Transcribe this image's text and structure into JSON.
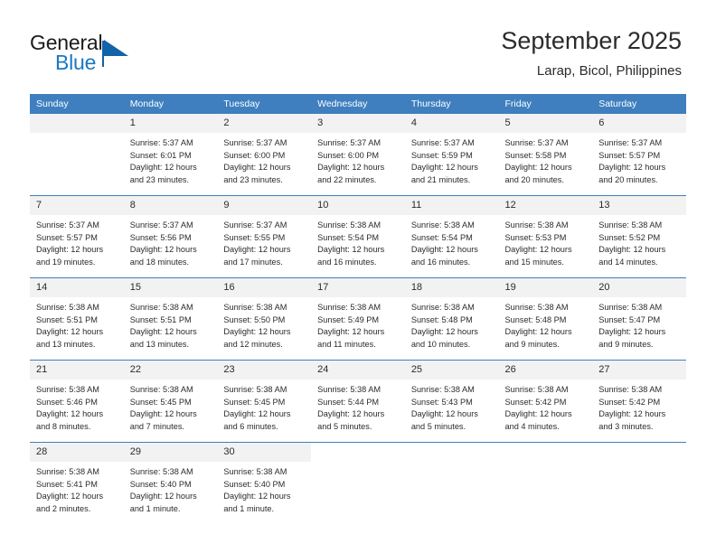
{
  "brand": {
    "name_part1": "General",
    "name_part2": "Blue",
    "logo_icon": "triangle-logo-icon",
    "accent_color": "#1878c4"
  },
  "header": {
    "title": "September 2025",
    "subtitle": "Larap, Bicol, Philippines"
  },
  "theme": {
    "header_bg": "#3f7fbf",
    "daynum_bg": "#f2f2f2",
    "text": "#2b2b2b"
  },
  "weekday_headers": [
    "Sunday",
    "Monday",
    "Tuesday",
    "Wednesday",
    "Thursday",
    "Friday",
    "Saturday"
  ],
  "weeks": [
    [
      {
        "day": "",
        "empty": true,
        "sunrise": "",
        "sunset": "",
        "daylight1": "",
        "daylight2": ""
      },
      {
        "day": "1",
        "sunrise": "Sunrise: 5:37 AM",
        "sunset": "Sunset: 6:01 PM",
        "daylight1": "Daylight: 12 hours",
        "daylight2": "and 23 minutes."
      },
      {
        "day": "2",
        "sunrise": "Sunrise: 5:37 AM",
        "sunset": "Sunset: 6:00 PM",
        "daylight1": "Daylight: 12 hours",
        "daylight2": "and 23 minutes."
      },
      {
        "day": "3",
        "sunrise": "Sunrise: 5:37 AM",
        "sunset": "Sunset: 6:00 PM",
        "daylight1": "Daylight: 12 hours",
        "daylight2": "and 22 minutes."
      },
      {
        "day": "4",
        "sunrise": "Sunrise: 5:37 AM",
        "sunset": "Sunset: 5:59 PM",
        "daylight1": "Daylight: 12 hours",
        "daylight2": "and 21 minutes."
      },
      {
        "day": "5",
        "sunrise": "Sunrise: 5:37 AM",
        "sunset": "Sunset: 5:58 PM",
        "daylight1": "Daylight: 12 hours",
        "daylight2": "and 20 minutes."
      },
      {
        "day": "6",
        "sunrise": "Sunrise: 5:37 AM",
        "sunset": "Sunset: 5:57 PM",
        "daylight1": "Daylight: 12 hours",
        "daylight2": "and 20 minutes."
      }
    ],
    [
      {
        "day": "7",
        "sunrise": "Sunrise: 5:37 AM",
        "sunset": "Sunset: 5:57 PM",
        "daylight1": "Daylight: 12 hours",
        "daylight2": "and 19 minutes."
      },
      {
        "day": "8",
        "sunrise": "Sunrise: 5:37 AM",
        "sunset": "Sunset: 5:56 PM",
        "daylight1": "Daylight: 12 hours",
        "daylight2": "and 18 minutes."
      },
      {
        "day": "9",
        "sunrise": "Sunrise: 5:37 AM",
        "sunset": "Sunset: 5:55 PM",
        "daylight1": "Daylight: 12 hours",
        "daylight2": "and 17 minutes."
      },
      {
        "day": "10",
        "sunrise": "Sunrise: 5:38 AM",
        "sunset": "Sunset: 5:54 PM",
        "daylight1": "Daylight: 12 hours",
        "daylight2": "and 16 minutes."
      },
      {
        "day": "11",
        "sunrise": "Sunrise: 5:38 AM",
        "sunset": "Sunset: 5:54 PM",
        "daylight1": "Daylight: 12 hours",
        "daylight2": "and 16 minutes."
      },
      {
        "day": "12",
        "sunrise": "Sunrise: 5:38 AM",
        "sunset": "Sunset: 5:53 PM",
        "daylight1": "Daylight: 12 hours",
        "daylight2": "and 15 minutes."
      },
      {
        "day": "13",
        "sunrise": "Sunrise: 5:38 AM",
        "sunset": "Sunset: 5:52 PM",
        "daylight1": "Daylight: 12 hours",
        "daylight2": "and 14 minutes."
      }
    ],
    [
      {
        "day": "14",
        "sunrise": "Sunrise: 5:38 AM",
        "sunset": "Sunset: 5:51 PM",
        "daylight1": "Daylight: 12 hours",
        "daylight2": "and 13 minutes."
      },
      {
        "day": "15",
        "sunrise": "Sunrise: 5:38 AM",
        "sunset": "Sunset: 5:51 PM",
        "daylight1": "Daylight: 12 hours",
        "daylight2": "and 13 minutes."
      },
      {
        "day": "16",
        "sunrise": "Sunrise: 5:38 AM",
        "sunset": "Sunset: 5:50 PM",
        "daylight1": "Daylight: 12 hours",
        "daylight2": "and 12 minutes."
      },
      {
        "day": "17",
        "sunrise": "Sunrise: 5:38 AM",
        "sunset": "Sunset: 5:49 PM",
        "daylight1": "Daylight: 12 hours",
        "daylight2": "and 11 minutes."
      },
      {
        "day": "18",
        "sunrise": "Sunrise: 5:38 AM",
        "sunset": "Sunset: 5:48 PM",
        "daylight1": "Daylight: 12 hours",
        "daylight2": "and 10 minutes."
      },
      {
        "day": "19",
        "sunrise": "Sunrise: 5:38 AM",
        "sunset": "Sunset: 5:48 PM",
        "daylight1": "Daylight: 12 hours",
        "daylight2": "and 9 minutes."
      },
      {
        "day": "20",
        "sunrise": "Sunrise: 5:38 AM",
        "sunset": "Sunset: 5:47 PM",
        "daylight1": "Daylight: 12 hours",
        "daylight2": "and 9 minutes."
      }
    ],
    [
      {
        "day": "21",
        "sunrise": "Sunrise: 5:38 AM",
        "sunset": "Sunset: 5:46 PM",
        "daylight1": "Daylight: 12 hours",
        "daylight2": "and 8 minutes."
      },
      {
        "day": "22",
        "sunrise": "Sunrise: 5:38 AM",
        "sunset": "Sunset: 5:45 PM",
        "daylight1": "Daylight: 12 hours",
        "daylight2": "and 7 minutes."
      },
      {
        "day": "23",
        "sunrise": "Sunrise: 5:38 AM",
        "sunset": "Sunset: 5:45 PM",
        "daylight1": "Daylight: 12 hours",
        "daylight2": "and 6 minutes."
      },
      {
        "day": "24",
        "sunrise": "Sunrise: 5:38 AM",
        "sunset": "Sunset: 5:44 PM",
        "daylight1": "Daylight: 12 hours",
        "daylight2": "and 5 minutes."
      },
      {
        "day": "25",
        "sunrise": "Sunrise: 5:38 AM",
        "sunset": "Sunset: 5:43 PM",
        "daylight1": "Daylight: 12 hours",
        "daylight2": "and 5 minutes."
      },
      {
        "day": "26",
        "sunrise": "Sunrise: 5:38 AM",
        "sunset": "Sunset: 5:42 PM",
        "daylight1": "Daylight: 12 hours",
        "daylight2": "and 4 minutes."
      },
      {
        "day": "27",
        "sunrise": "Sunrise: 5:38 AM",
        "sunset": "Sunset: 5:42 PM",
        "daylight1": "Daylight: 12 hours",
        "daylight2": "and 3 minutes."
      }
    ],
    [
      {
        "day": "28",
        "sunrise": "Sunrise: 5:38 AM",
        "sunset": "Sunset: 5:41 PM",
        "daylight1": "Daylight: 12 hours",
        "daylight2": "and 2 minutes."
      },
      {
        "day": "29",
        "sunrise": "Sunrise: 5:38 AM",
        "sunset": "Sunset: 5:40 PM",
        "daylight1": "Daylight: 12 hours",
        "daylight2": "and 1 minute."
      },
      {
        "day": "30",
        "sunrise": "Sunrise: 5:38 AM",
        "sunset": "Sunset: 5:40 PM",
        "daylight1": "Daylight: 12 hours",
        "daylight2": "and 1 minute."
      },
      {
        "day": "",
        "blank": true,
        "sunrise": "",
        "sunset": "",
        "daylight1": "",
        "daylight2": ""
      },
      {
        "day": "",
        "blank": true,
        "sunrise": "",
        "sunset": "",
        "daylight1": "",
        "daylight2": ""
      },
      {
        "day": "",
        "blank": true,
        "sunrise": "",
        "sunset": "",
        "daylight1": "",
        "daylight2": ""
      },
      {
        "day": "",
        "blank": true,
        "sunrise": "",
        "sunset": "",
        "daylight1": "",
        "daylight2": ""
      }
    ]
  ]
}
